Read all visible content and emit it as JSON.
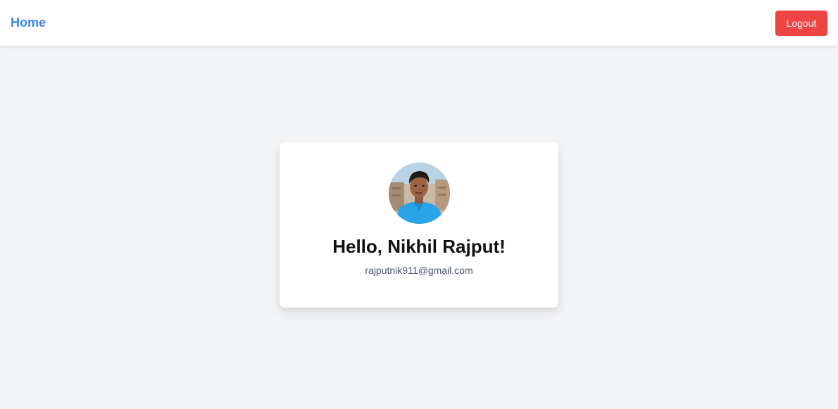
{
  "navbar": {
    "brand": "Home",
    "logout_label": "Logout"
  },
  "profile": {
    "greeting": "Hello, Nikhil Rajput!",
    "email": "rajputnik911@gmail.com",
    "avatar_icon": "user-photo-avatar"
  },
  "colors": {
    "brand": "#3b82f6",
    "logout": "#ef4444",
    "page_background": "#f3f4f6",
    "card_background": "#ffffff"
  }
}
